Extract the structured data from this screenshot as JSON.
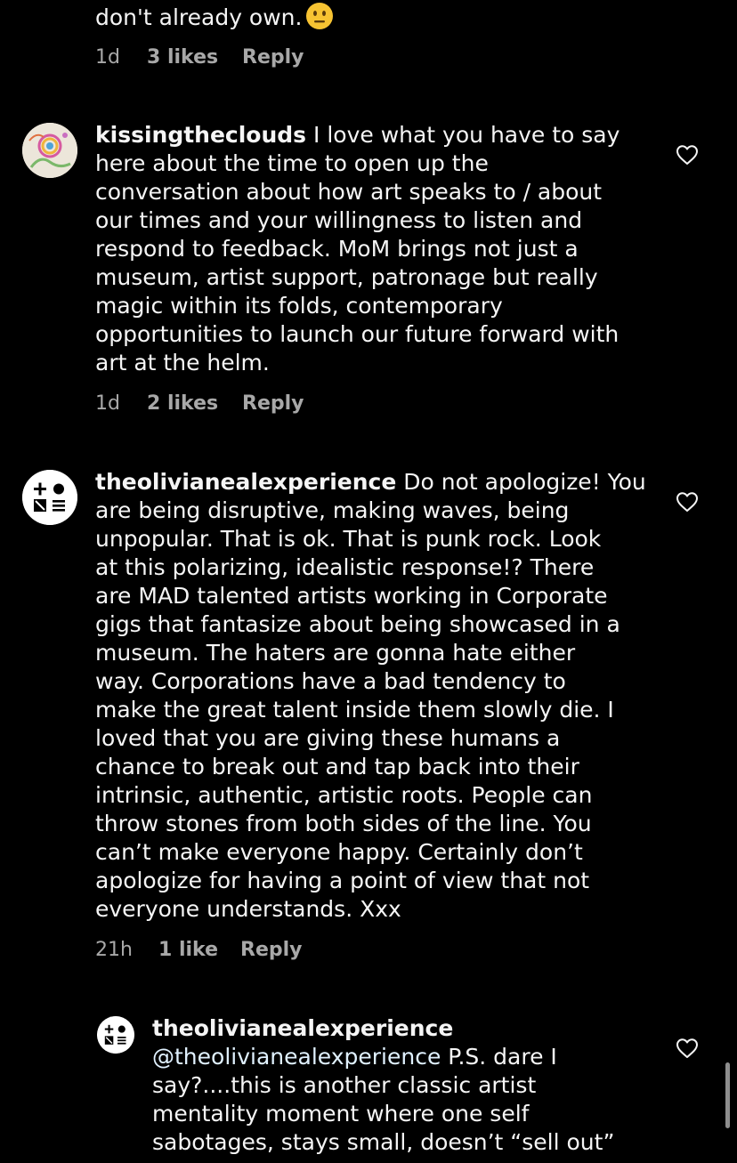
{
  "top_comment": {
    "text_tail": "don't already own.",
    "emoji": "neutral-face",
    "time": "1d",
    "likes": "3 likes",
    "reply": "Reply"
  },
  "comments": [
    {
      "username": "kissingtheclouds",
      "text": "I love what you have to say\nhere about the time to open up the\nconversation about how art speaks to / about\nour times and your willingness to listen and\nrespond to feedback. MoM brings not just a\nmuseum, artist support, patronage but really\nmagic within its folds, contemporary\nopportunities to launch our future forward with\nart at the helm.",
      "time": "1d",
      "likes": "2 likes",
      "reply": "Reply"
    },
    {
      "username": "theolivianealexperience",
      "text": "Do not apologize! You\nare being disruptive, making waves, being\nunpopular. That is ok. That is punk rock. Look\nat this polarizing, idealistic response!? There\nare MAD talented artists working in Corporate\ngigs that fantasize about being showcased in a\nmuseum. The haters are gonna hate either\nway. Corporations have a bad tendency to\nmake the great talent inside them slowly die. I\nloved that you are giving these humans a\nchance to break out and tap back into their\nintrinsic, authentic, artistic roots. People can\nthrow stones from both sides of the line. You\ncan’t make everyone happy. Certainly don’t\napologize for having a point of view that not\neveryone understands. Xxx",
      "time": "21h",
      "likes": "1 like",
      "reply": "Reply"
    }
  ],
  "reply_comment": {
    "username": "theolivianealexperience",
    "mention": "@theolivianealexperience",
    "text": " P.S. dare I\nsay?....this is another classic artist\nmentality moment where one self\nsabotages, stays small, doesn’t “sell out”"
  },
  "icons": {
    "like": "heart-outline-icon",
    "emoji": "neutral-face-emoji"
  },
  "colors": {
    "background": "#000000",
    "text": "#f5f5f5",
    "meta": "#a8a8a8"
  }
}
